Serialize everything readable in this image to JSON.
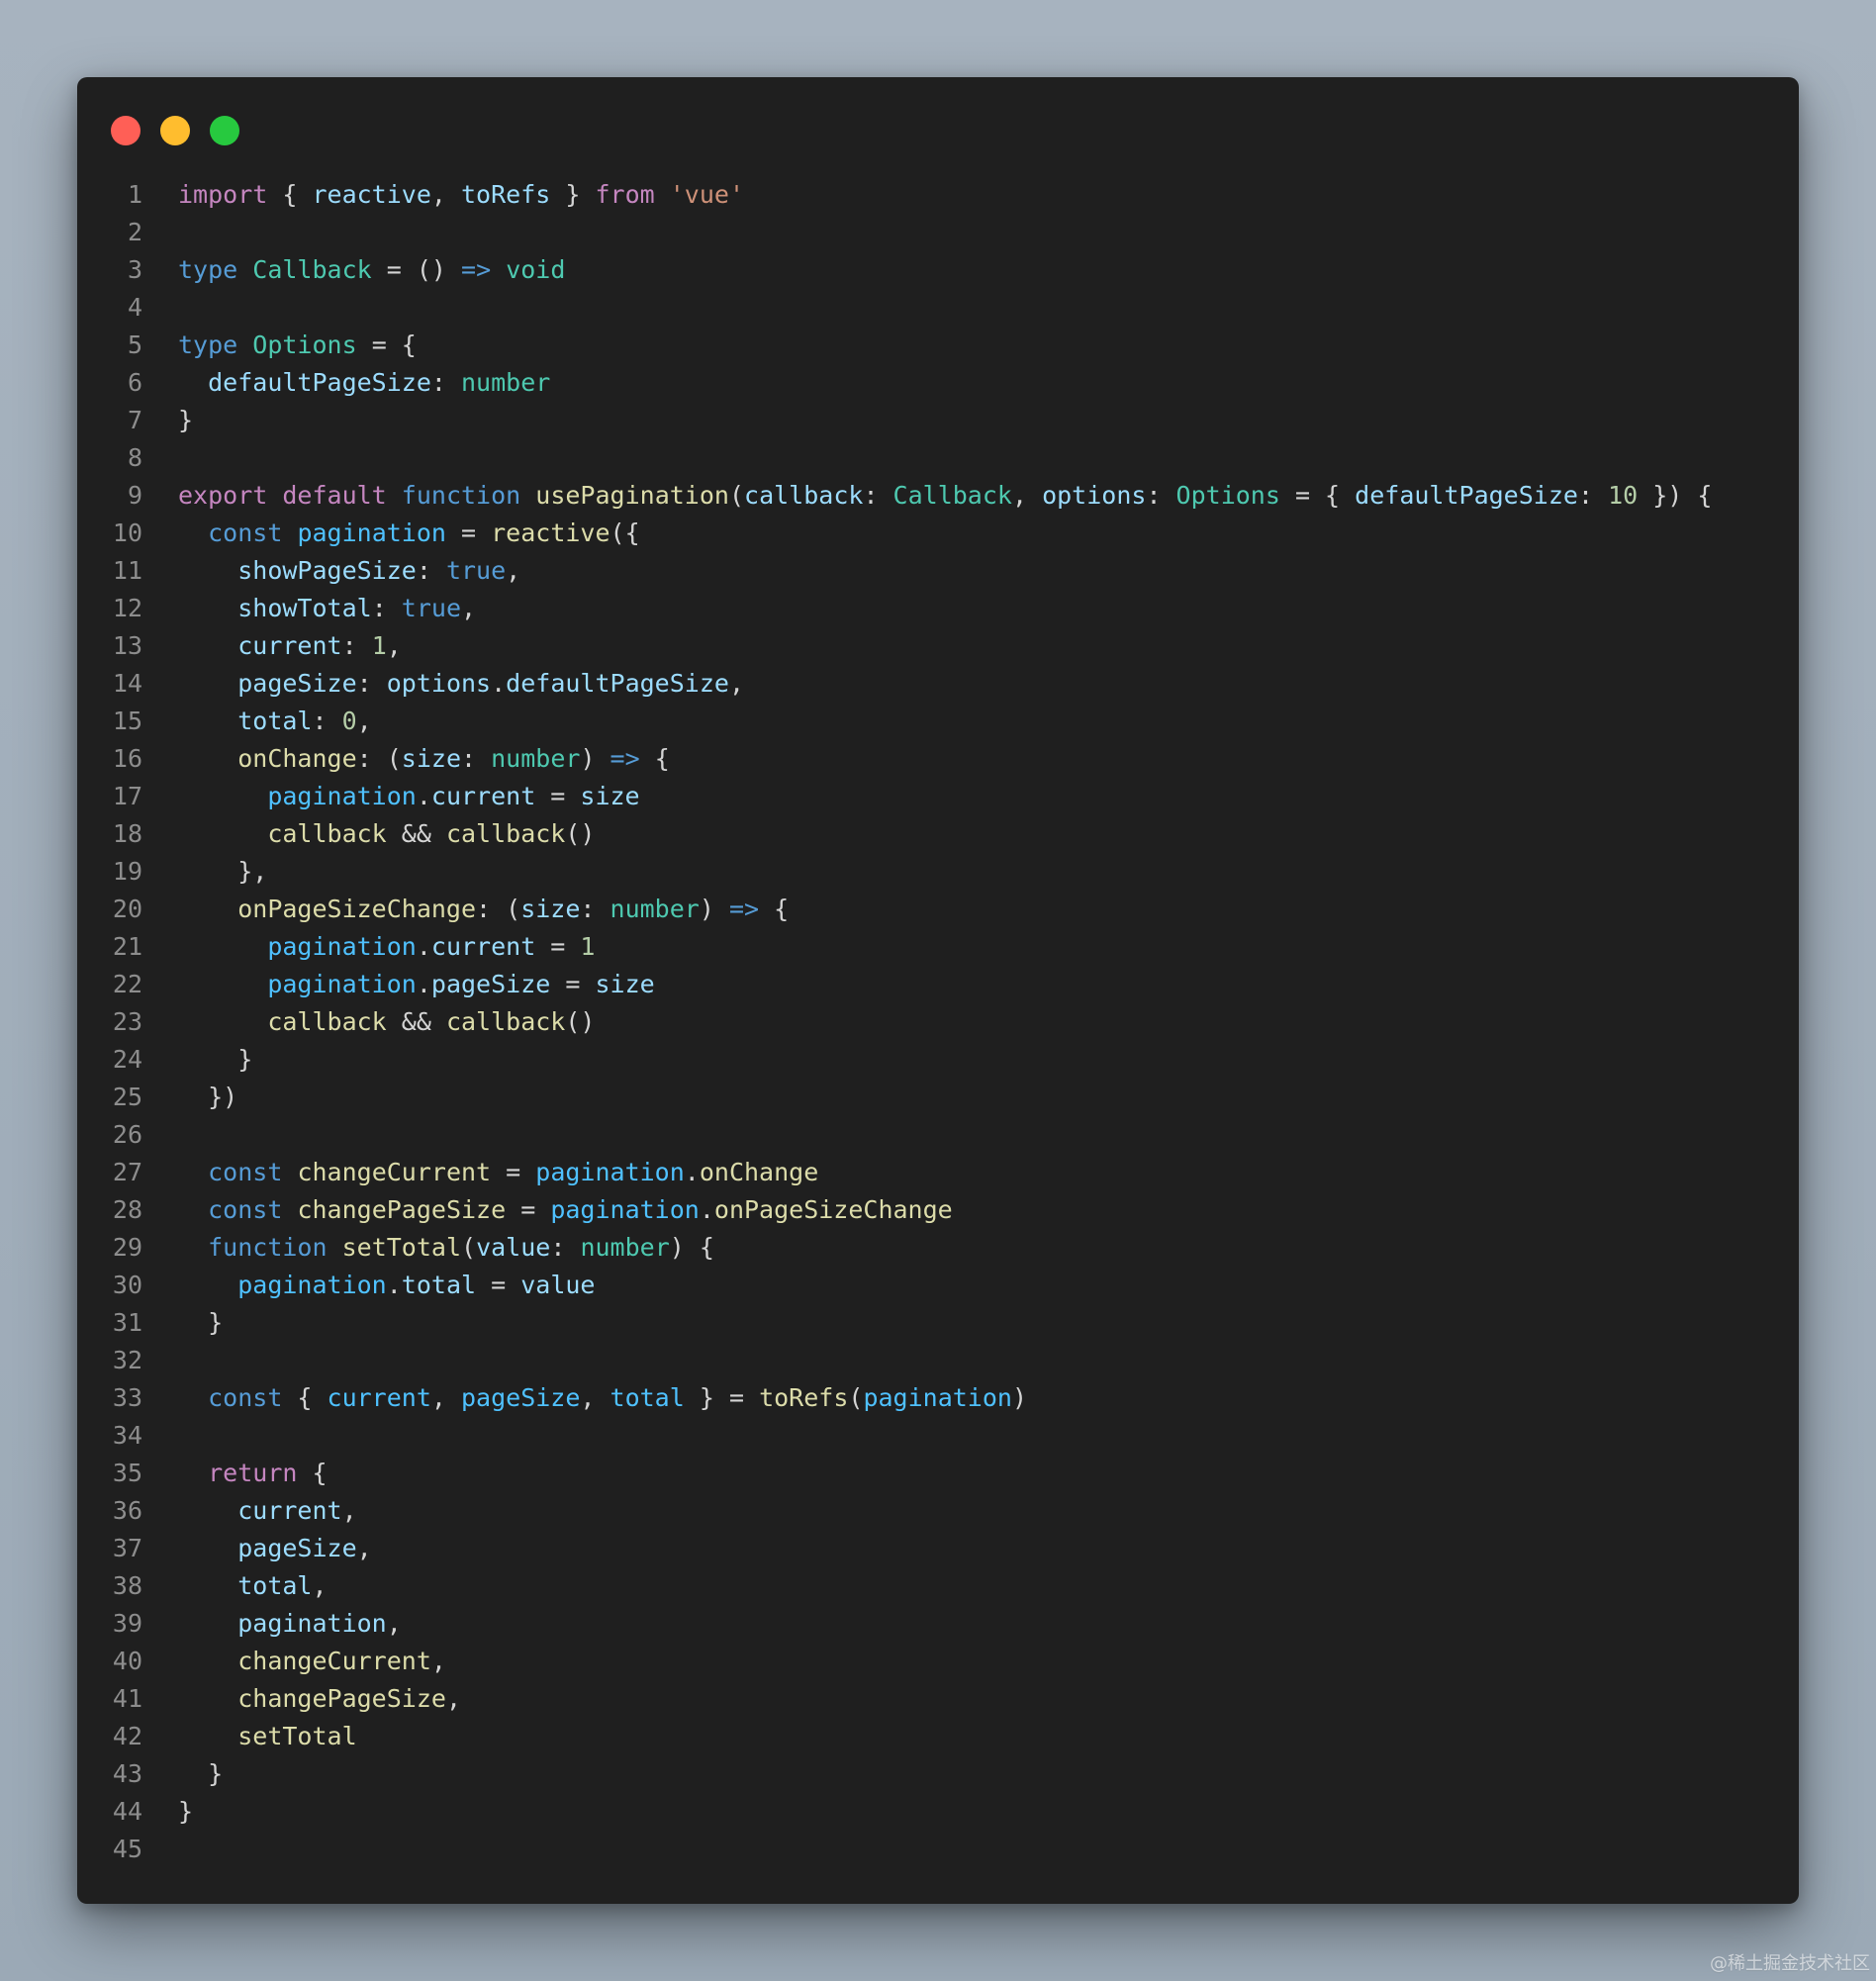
{
  "window": {
    "controls": [
      "close",
      "minimize",
      "maximize"
    ]
  },
  "code": {
    "lines": [
      {
        "n": "1",
        "tokens": [
          {
            "t": "import",
            "c": "kw-purple"
          },
          {
            "t": " { ",
            "c": "punc"
          },
          {
            "t": "reactive",
            "c": "var"
          },
          {
            "t": ", ",
            "c": "punc"
          },
          {
            "t": "toRefs",
            "c": "var"
          },
          {
            "t": " } ",
            "c": "punc"
          },
          {
            "t": "from",
            "c": "kw-purple"
          },
          {
            "t": " ",
            "c": "punc"
          },
          {
            "t": "'vue'",
            "c": "str"
          }
        ]
      },
      {
        "n": "2",
        "tokens": []
      },
      {
        "n": "3",
        "tokens": [
          {
            "t": "type",
            "c": "kw-blue"
          },
          {
            "t": " ",
            "c": "punc"
          },
          {
            "t": "Callback",
            "c": "type"
          },
          {
            "t": " = () ",
            "c": "punc"
          },
          {
            "t": "=>",
            "c": "kw-blue"
          },
          {
            "t": " ",
            "c": "punc"
          },
          {
            "t": "void",
            "c": "type"
          }
        ]
      },
      {
        "n": "4",
        "tokens": []
      },
      {
        "n": "5",
        "tokens": [
          {
            "t": "type",
            "c": "kw-blue"
          },
          {
            "t": " ",
            "c": "punc"
          },
          {
            "t": "Options",
            "c": "type"
          },
          {
            "t": " = {",
            "c": "punc"
          }
        ]
      },
      {
        "n": "6",
        "tokens": [
          {
            "t": "  ",
            "c": "punc"
          },
          {
            "t": "defaultPageSize",
            "c": "var"
          },
          {
            "t": ": ",
            "c": "punc"
          },
          {
            "t": "number",
            "c": "type"
          }
        ]
      },
      {
        "n": "7",
        "tokens": [
          {
            "t": "}",
            "c": "punc"
          }
        ]
      },
      {
        "n": "8",
        "tokens": []
      },
      {
        "n": "9",
        "tokens": [
          {
            "t": "export",
            "c": "kw-purple"
          },
          {
            "t": " ",
            "c": "punc"
          },
          {
            "t": "default",
            "c": "kw-purple"
          },
          {
            "t": " ",
            "c": "punc"
          },
          {
            "t": "function",
            "c": "kw-blue"
          },
          {
            "t": " ",
            "c": "punc"
          },
          {
            "t": "usePagination",
            "c": "func"
          },
          {
            "t": "(",
            "c": "punc"
          },
          {
            "t": "callback",
            "c": "var"
          },
          {
            "t": ": ",
            "c": "punc"
          },
          {
            "t": "Callback",
            "c": "type"
          },
          {
            "t": ", ",
            "c": "punc"
          },
          {
            "t": "options",
            "c": "var"
          },
          {
            "t": ": ",
            "c": "punc"
          },
          {
            "t": "Options",
            "c": "type"
          },
          {
            "t": " = { ",
            "c": "punc"
          },
          {
            "t": "defaultPageSize",
            "c": "var"
          },
          {
            "t": ": ",
            "c": "punc"
          },
          {
            "t": "10",
            "c": "num"
          },
          {
            "t": " }) {",
            "c": "punc"
          }
        ]
      },
      {
        "n": "10",
        "tokens": [
          {
            "t": "  ",
            "c": "punc"
          },
          {
            "t": "const",
            "c": "kw-blue"
          },
          {
            "t": " ",
            "c": "punc"
          },
          {
            "t": "pagination",
            "c": "const"
          },
          {
            "t": " = ",
            "c": "punc"
          },
          {
            "t": "reactive",
            "c": "func"
          },
          {
            "t": "({",
            "c": "punc"
          }
        ]
      },
      {
        "n": "11",
        "tokens": [
          {
            "t": "    ",
            "c": "punc"
          },
          {
            "t": "showPageSize",
            "c": "var"
          },
          {
            "t": ": ",
            "c": "punc"
          },
          {
            "t": "true",
            "c": "kw-blue"
          },
          {
            "t": ",",
            "c": "punc"
          }
        ]
      },
      {
        "n": "12",
        "tokens": [
          {
            "t": "    ",
            "c": "punc"
          },
          {
            "t": "showTotal",
            "c": "var"
          },
          {
            "t": ": ",
            "c": "punc"
          },
          {
            "t": "true",
            "c": "kw-blue"
          },
          {
            "t": ",",
            "c": "punc"
          }
        ]
      },
      {
        "n": "13",
        "tokens": [
          {
            "t": "    ",
            "c": "punc"
          },
          {
            "t": "current",
            "c": "var"
          },
          {
            "t": ": ",
            "c": "punc"
          },
          {
            "t": "1",
            "c": "num"
          },
          {
            "t": ",",
            "c": "punc"
          }
        ]
      },
      {
        "n": "14",
        "tokens": [
          {
            "t": "    ",
            "c": "punc"
          },
          {
            "t": "pageSize",
            "c": "var"
          },
          {
            "t": ": ",
            "c": "punc"
          },
          {
            "t": "options",
            "c": "var"
          },
          {
            "t": ".",
            "c": "punc"
          },
          {
            "t": "defaultPageSize",
            "c": "var"
          },
          {
            "t": ",",
            "c": "punc"
          }
        ]
      },
      {
        "n": "15",
        "tokens": [
          {
            "t": "    ",
            "c": "punc"
          },
          {
            "t": "total",
            "c": "var"
          },
          {
            "t": ": ",
            "c": "punc"
          },
          {
            "t": "0",
            "c": "num"
          },
          {
            "t": ",",
            "c": "punc"
          }
        ]
      },
      {
        "n": "16",
        "tokens": [
          {
            "t": "    ",
            "c": "punc"
          },
          {
            "t": "onChange",
            "c": "func"
          },
          {
            "t": ": (",
            "c": "punc"
          },
          {
            "t": "size",
            "c": "var"
          },
          {
            "t": ": ",
            "c": "punc"
          },
          {
            "t": "number",
            "c": "type"
          },
          {
            "t": ") ",
            "c": "punc"
          },
          {
            "t": "=>",
            "c": "kw-blue"
          },
          {
            "t": " {",
            "c": "punc"
          }
        ]
      },
      {
        "n": "17",
        "tokens": [
          {
            "t": "      ",
            "c": "punc"
          },
          {
            "t": "pagination",
            "c": "const"
          },
          {
            "t": ".",
            "c": "punc"
          },
          {
            "t": "current",
            "c": "var"
          },
          {
            "t": " = ",
            "c": "punc"
          },
          {
            "t": "size",
            "c": "var"
          }
        ]
      },
      {
        "n": "18",
        "tokens": [
          {
            "t": "      ",
            "c": "punc"
          },
          {
            "t": "callback",
            "c": "func"
          },
          {
            "t": " && ",
            "c": "punc"
          },
          {
            "t": "callback",
            "c": "func"
          },
          {
            "t": "()",
            "c": "punc"
          }
        ]
      },
      {
        "n": "19",
        "tokens": [
          {
            "t": "    },",
            "c": "punc"
          }
        ]
      },
      {
        "n": "20",
        "tokens": [
          {
            "t": "    ",
            "c": "punc"
          },
          {
            "t": "onPageSizeChange",
            "c": "func"
          },
          {
            "t": ": (",
            "c": "punc"
          },
          {
            "t": "size",
            "c": "var"
          },
          {
            "t": ": ",
            "c": "punc"
          },
          {
            "t": "number",
            "c": "type"
          },
          {
            "t": ") ",
            "c": "punc"
          },
          {
            "t": "=>",
            "c": "kw-blue"
          },
          {
            "t": " {",
            "c": "punc"
          }
        ]
      },
      {
        "n": "21",
        "tokens": [
          {
            "t": "      ",
            "c": "punc"
          },
          {
            "t": "pagination",
            "c": "const"
          },
          {
            "t": ".",
            "c": "punc"
          },
          {
            "t": "current",
            "c": "var"
          },
          {
            "t": " = ",
            "c": "punc"
          },
          {
            "t": "1",
            "c": "num"
          }
        ]
      },
      {
        "n": "22",
        "tokens": [
          {
            "t": "      ",
            "c": "punc"
          },
          {
            "t": "pagination",
            "c": "const"
          },
          {
            "t": ".",
            "c": "punc"
          },
          {
            "t": "pageSize",
            "c": "var"
          },
          {
            "t": " = ",
            "c": "punc"
          },
          {
            "t": "size",
            "c": "var"
          }
        ]
      },
      {
        "n": "23",
        "tokens": [
          {
            "t": "      ",
            "c": "punc"
          },
          {
            "t": "callback",
            "c": "func"
          },
          {
            "t": " && ",
            "c": "punc"
          },
          {
            "t": "callback",
            "c": "func"
          },
          {
            "t": "()",
            "c": "punc"
          }
        ]
      },
      {
        "n": "24",
        "tokens": [
          {
            "t": "    }",
            "c": "punc"
          }
        ]
      },
      {
        "n": "25",
        "tokens": [
          {
            "t": "  })",
            "c": "punc"
          }
        ]
      },
      {
        "n": "26",
        "tokens": []
      },
      {
        "n": "27",
        "tokens": [
          {
            "t": "  ",
            "c": "punc"
          },
          {
            "t": "const",
            "c": "kw-blue"
          },
          {
            "t": " ",
            "c": "punc"
          },
          {
            "t": "changeCurrent",
            "c": "func"
          },
          {
            "t": " = ",
            "c": "punc"
          },
          {
            "t": "pagination",
            "c": "const"
          },
          {
            "t": ".",
            "c": "punc"
          },
          {
            "t": "onChange",
            "c": "func"
          }
        ]
      },
      {
        "n": "28",
        "tokens": [
          {
            "t": "  ",
            "c": "punc"
          },
          {
            "t": "const",
            "c": "kw-blue"
          },
          {
            "t": " ",
            "c": "punc"
          },
          {
            "t": "changePageSize",
            "c": "func"
          },
          {
            "t": " = ",
            "c": "punc"
          },
          {
            "t": "pagination",
            "c": "const"
          },
          {
            "t": ".",
            "c": "punc"
          },
          {
            "t": "onPageSizeChange",
            "c": "func"
          }
        ]
      },
      {
        "n": "29",
        "tokens": [
          {
            "t": "  ",
            "c": "punc"
          },
          {
            "t": "function",
            "c": "kw-blue"
          },
          {
            "t": " ",
            "c": "punc"
          },
          {
            "t": "setTotal",
            "c": "func"
          },
          {
            "t": "(",
            "c": "punc"
          },
          {
            "t": "value",
            "c": "var"
          },
          {
            "t": ": ",
            "c": "punc"
          },
          {
            "t": "number",
            "c": "type"
          },
          {
            "t": ") {",
            "c": "punc"
          }
        ]
      },
      {
        "n": "30",
        "tokens": [
          {
            "t": "    ",
            "c": "punc"
          },
          {
            "t": "pagination",
            "c": "const"
          },
          {
            "t": ".",
            "c": "punc"
          },
          {
            "t": "total",
            "c": "var"
          },
          {
            "t": " = ",
            "c": "punc"
          },
          {
            "t": "value",
            "c": "var"
          }
        ]
      },
      {
        "n": "31",
        "tokens": [
          {
            "t": "  }",
            "c": "punc"
          }
        ]
      },
      {
        "n": "32",
        "tokens": []
      },
      {
        "n": "33",
        "tokens": [
          {
            "t": "  ",
            "c": "punc"
          },
          {
            "t": "const",
            "c": "kw-blue"
          },
          {
            "t": " { ",
            "c": "punc"
          },
          {
            "t": "current",
            "c": "const"
          },
          {
            "t": ", ",
            "c": "punc"
          },
          {
            "t": "pageSize",
            "c": "const"
          },
          {
            "t": ", ",
            "c": "punc"
          },
          {
            "t": "total",
            "c": "const"
          },
          {
            "t": " } = ",
            "c": "punc"
          },
          {
            "t": "toRefs",
            "c": "func"
          },
          {
            "t": "(",
            "c": "punc"
          },
          {
            "t": "pagination",
            "c": "const"
          },
          {
            "t": ")",
            "c": "punc"
          }
        ]
      },
      {
        "n": "34",
        "tokens": []
      },
      {
        "n": "35",
        "tokens": [
          {
            "t": "  ",
            "c": "punc"
          },
          {
            "t": "return",
            "c": "kw-purple"
          },
          {
            "t": " {",
            "c": "punc"
          }
        ]
      },
      {
        "n": "36",
        "tokens": [
          {
            "t": "    ",
            "c": "punc"
          },
          {
            "t": "current",
            "c": "var"
          },
          {
            "t": ",",
            "c": "punc"
          }
        ]
      },
      {
        "n": "37",
        "tokens": [
          {
            "t": "    ",
            "c": "punc"
          },
          {
            "t": "pageSize",
            "c": "var"
          },
          {
            "t": ",",
            "c": "punc"
          }
        ]
      },
      {
        "n": "38",
        "tokens": [
          {
            "t": "    ",
            "c": "punc"
          },
          {
            "t": "total",
            "c": "var"
          },
          {
            "t": ",",
            "c": "punc"
          }
        ]
      },
      {
        "n": "39",
        "tokens": [
          {
            "t": "    ",
            "c": "punc"
          },
          {
            "t": "pagination",
            "c": "var"
          },
          {
            "t": ",",
            "c": "punc"
          }
        ]
      },
      {
        "n": "40",
        "tokens": [
          {
            "t": "    ",
            "c": "punc"
          },
          {
            "t": "changeCurrent",
            "c": "func"
          },
          {
            "t": ",",
            "c": "punc"
          }
        ]
      },
      {
        "n": "41",
        "tokens": [
          {
            "t": "    ",
            "c": "punc"
          },
          {
            "t": "changePageSize",
            "c": "func"
          },
          {
            "t": ",",
            "c": "punc"
          }
        ]
      },
      {
        "n": "42",
        "tokens": [
          {
            "t": "    ",
            "c": "punc"
          },
          {
            "t": "setTotal",
            "c": "func"
          }
        ]
      },
      {
        "n": "43",
        "tokens": [
          {
            "t": "  }",
            "c": "punc"
          }
        ]
      },
      {
        "n": "44",
        "tokens": [
          {
            "t": "}",
            "c": "punc"
          }
        ]
      },
      {
        "n": "45",
        "tokens": []
      }
    ]
  },
  "watermark": "@稀土掘金技术社区",
  "colors": {
    "background": "#a7b3bf",
    "window": "#1f1f1f",
    "close": "#ff5f56",
    "minimize": "#ffbd2e",
    "maximize": "#27c93f"
  }
}
